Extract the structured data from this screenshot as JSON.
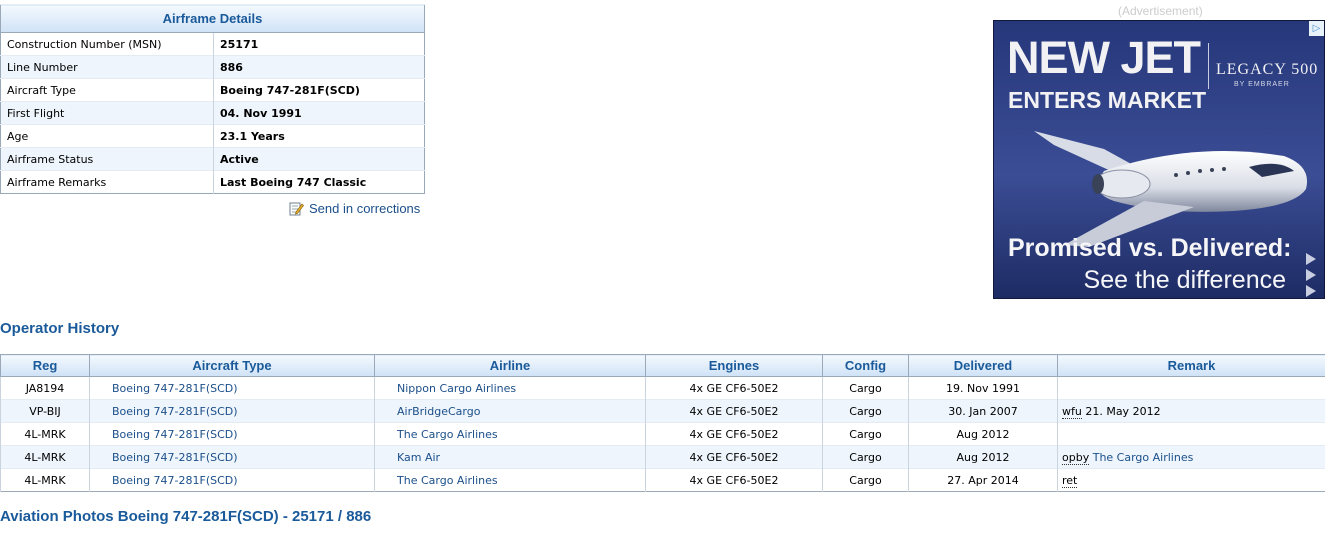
{
  "airframe": {
    "title": "Airframe Details",
    "rows": [
      {
        "label": "Construction Number (MSN)",
        "value": "25171"
      },
      {
        "label": "Line Number",
        "value": "886"
      },
      {
        "label": "Aircraft Type",
        "value": "Boeing 747-281F(SCD)"
      },
      {
        "label": "First Flight",
        "value": "04. Nov 1991"
      },
      {
        "label": "Age",
        "value": "23.1 Years"
      },
      {
        "label": "Airframe Status",
        "value": "Active"
      },
      {
        "label": "Airframe Remarks",
        "value": "Last Boeing 747 Classic"
      }
    ],
    "corrections_link": "Send in corrections",
    "corrections_icon": "edit-note-icon"
  },
  "ad": {
    "label": "(Advertisement)",
    "headline1": "NEW JET",
    "headline2": "ENTERS MARKET",
    "brand": "LEGACY 500",
    "brand_sub": "BY EMBRAER",
    "tagline1": "Promised vs. Delivered:",
    "tagline2": "See the difference",
    "adchoices_icon": "adchoices-icon",
    "colors": {
      "background": "#1e2f66"
    }
  },
  "operator_history": {
    "title": "Operator History",
    "columns": [
      "Reg",
      "Aircraft Type",
      "Airline",
      "Engines",
      "Config",
      "Delivered",
      "Remark"
    ],
    "rows": [
      {
        "reg": "JA8194",
        "type": "Boeing 747-281F(SCD)",
        "airline": "Nippon Cargo Airlines",
        "engines": "4x GE CF6-50E2",
        "config": "Cargo",
        "delivered": "19. Nov 1991",
        "remark_abbr": "",
        "remark_text": ""
      },
      {
        "reg": "VP-BIJ",
        "type": "Boeing 747-281F(SCD)",
        "airline": "AirBridgeCargo",
        "engines": "4x GE CF6-50E2",
        "config": "Cargo",
        "delivered": "30. Jan 2007",
        "remark_abbr": "wfu",
        "remark_text": " 21. May 2012"
      },
      {
        "reg": "4L-MRK",
        "type": "Boeing 747-281F(SCD)",
        "airline": "The Cargo Airlines",
        "engines": "4x GE CF6-50E2",
        "config": "Cargo",
        "delivered": "Aug 2012",
        "remark_abbr": "",
        "remark_text": ""
      },
      {
        "reg": "4L-MRK",
        "type": "Boeing 747-281F(SCD)",
        "airline": "Kam Air",
        "engines": "4x GE CF6-50E2",
        "config": "Cargo",
        "delivered": "Aug 2012",
        "remark_abbr": "opby",
        "remark_link": "The Cargo Airlines"
      },
      {
        "reg": "4L-MRK",
        "type": "Boeing 747-281F(SCD)",
        "airline": "The Cargo Airlines",
        "engines": "4x GE CF6-50E2",
        "config": "Cargo",
        "delivered": "27. Apr 2014",
        "remark_abbr": "ret",
        "remark_text": ""
      }
    ]
  },
  "photos_title": "Aviation Photos Boeing 747-281F(SCD) - 25171 / 886"
}
